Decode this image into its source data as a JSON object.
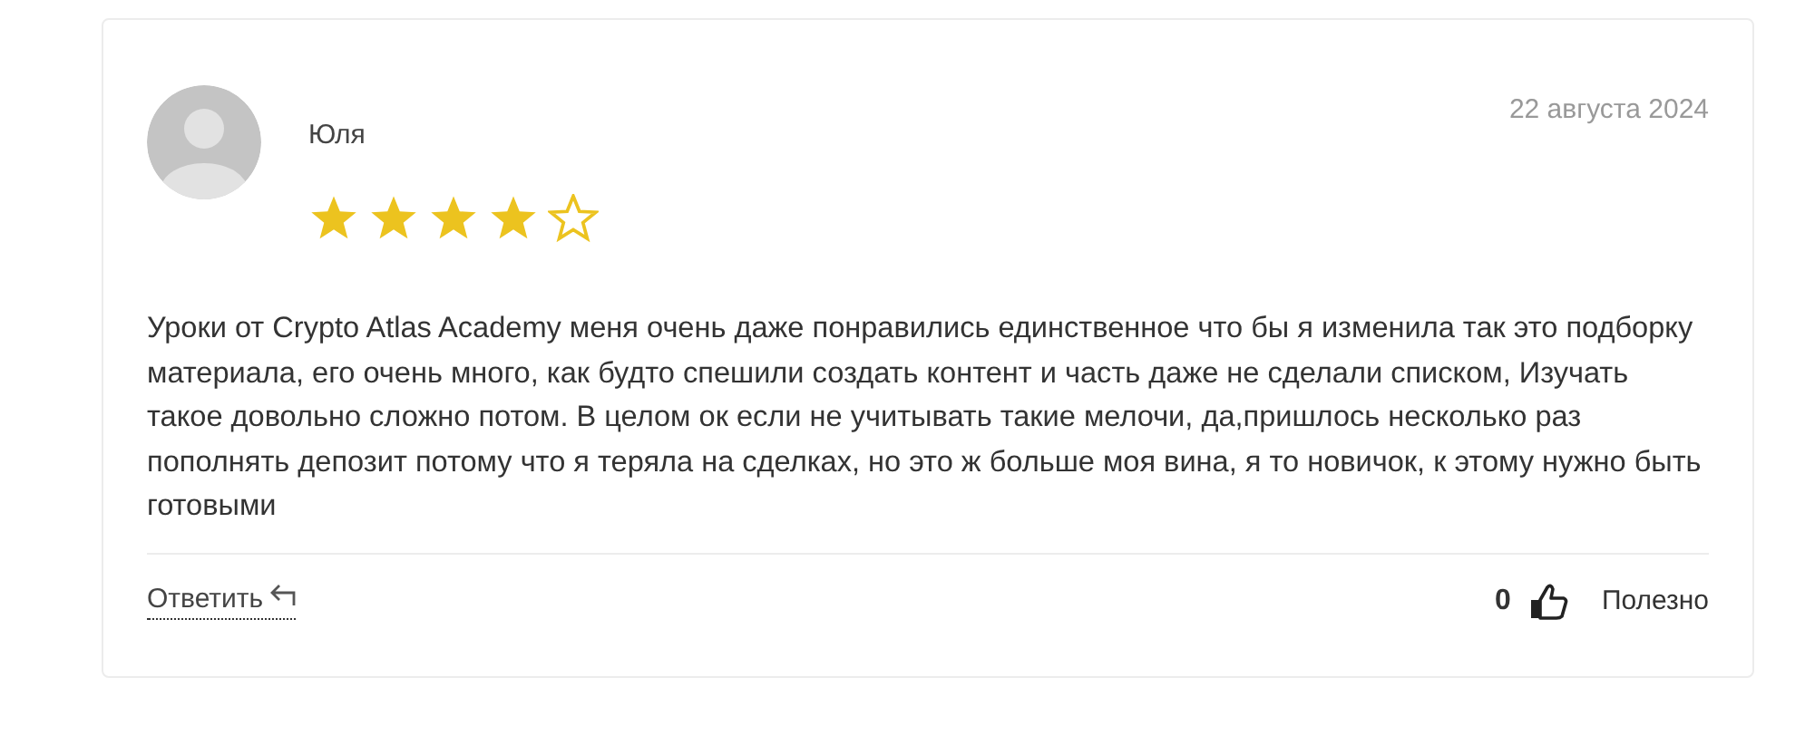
{
  "review": {
    "author": "Юля",
    "date": "22 августа 2024",
    "stars": 4,
    "text": "Уроки от Crypto Atlas Academy меня очень даже понравились единственное что бы я изменила так это подборку материала, его очень много, как будто спешили создать контент и часть даже не сделали списком, Изучать такое довольно сложно потом. В целом ок если не учитывать такие мелочи, да,пришлось несколько раз пополнять депозит потому что я теряла на сделках, но это ж больше моя вина, я то новичок, к этому нужно быть готовыми",
    "reply_link": "Ответить",
    "helpful_count": "0",
    "helpful_label": "Полезно"
  }
}
